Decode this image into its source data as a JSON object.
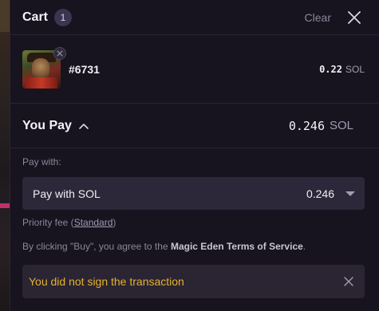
{
  "cart": {
    "title": "Cart",
    "count": "1",
    "clear_label": "Clear"
  },
  "item": {
    "name": "#6731",
    "price": "0.22",
    "unit": "SOL"
  },
  "you_pay": {
    "label": "You Pay",
    "total": "0.246",
    "unit": "SOL"
  },
  "payment": {
    "pay_with_label": "Pay with:",
    "selected_label": "Pay with SOL",
    "selected_value": "0.246"
  },
  "priority_fee": {
    "prefix": "Priority fee (",
    "link": "Standard",
    "suffix": ")"
  },
  "terms": {
    "prefix": "By clicking \"Buy\", you agree to the ",
    "link": "Magic Eden Terms of Service",
    "suffix": "."
  },
  "error": {
    "message": "You did not sign the transaction"
  },
  "colors": {
    "background": "#17131f",
    "panel": "#2d2839",
    "warning": "#e5b22e",
    "muted": "#8b879a"
  },
  "icons": [
    "close-icon",
    "chevron-up-icon",
    "caret-down-icon",
    "remove-icon"
  ]
}
